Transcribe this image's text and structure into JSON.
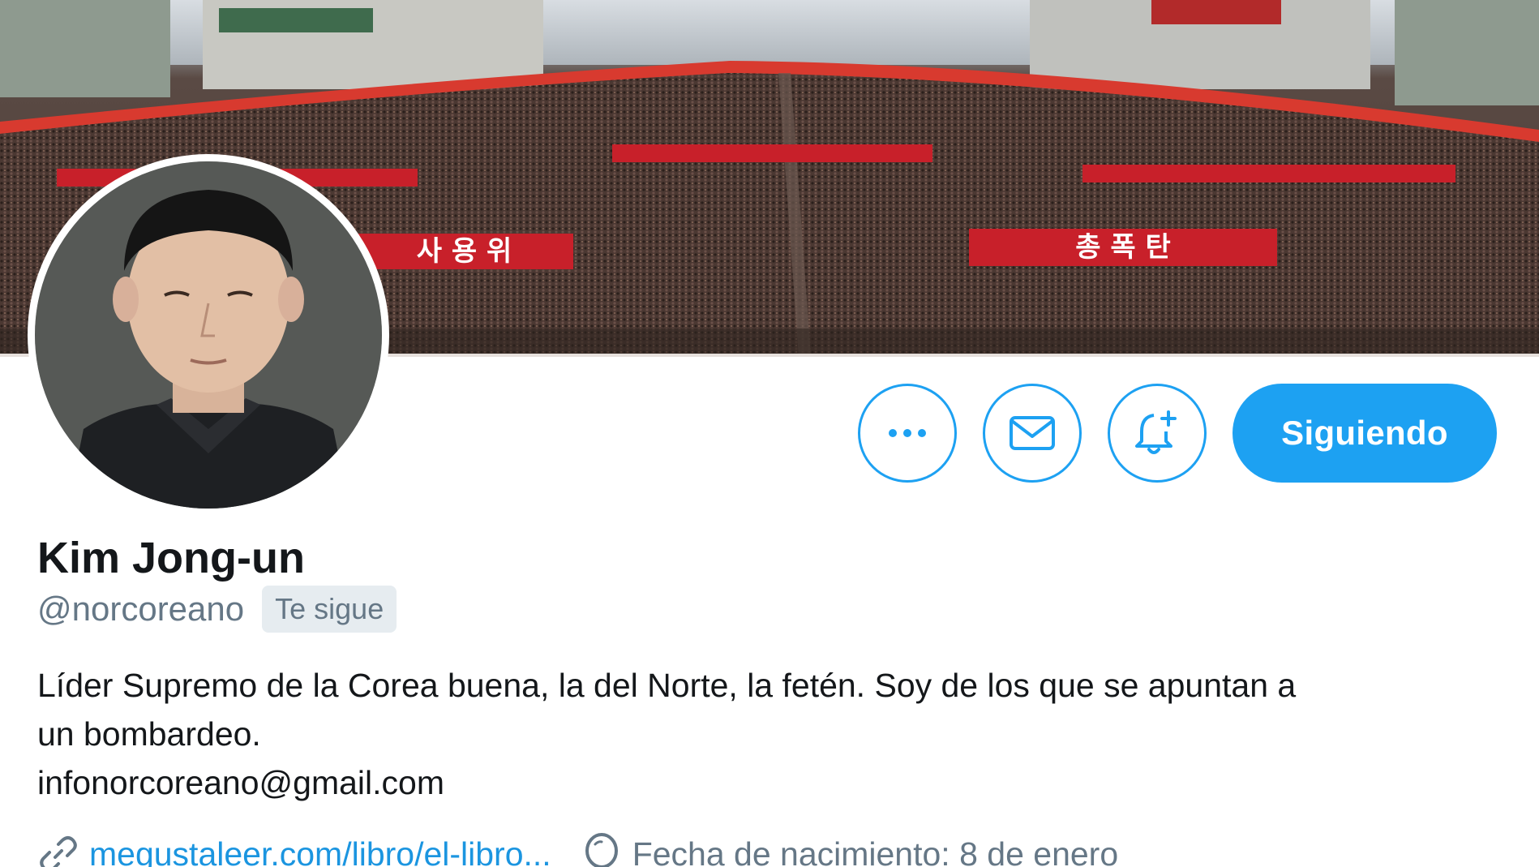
{
  "profile": {
    "name": "Kim Jong-un",
    "handle": "@norcoreano",
    "follows_you_badge": "Te sigue",
    "bio_line1": "Líder Supremo de la Corea buena, la del Norte, la fetén. Soy de los que se apuntan a",
    "bio_line2": "un bombardeo.",
    "bio_line3": "infonorcoreano@gmail.com",
    "website": "megustaleer.com/libro/el-libro...",
    "birthday": "Fecha de nacimiento: 8 de enero"
  },
  "actions": {
    "more_icon": "more-horizontal-icon",
    "message_icon": "envelope-icon",
    "notify_icon": "bell-plus-icon",
    "follow_label": "Siguiendo"
  },
  "banner": {
    "sign_left": "사 용 위",
    "sign_right": "총 폭 탄"
  },
  "colors": {
    "accent": "#1da1f2",
    "link": "#1b95e0",
    "secondary_text": "#657786",
    "badge_bg": "#e6ecf0"
  },
  "icons": {
    "website": "link-icon",
    "birthday": "balloon-icon"
  }
}
